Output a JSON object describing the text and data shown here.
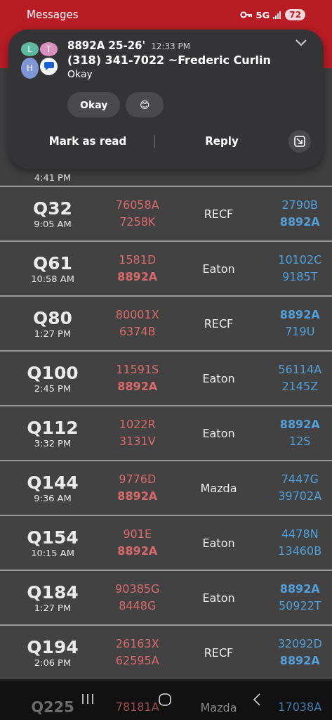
{
  "status_bar": {
    "app": "Messages",
    "network": "5G",
    "battery": "72"
  },
  "notification": {
    "avatar_letters": [
      "L",
      "T",
      "H"
    ],
    "title": "8892A 25-26'",
    "time": "12:33 PM",
    "sender": "(318) 341-7022 ~Frederic Curlin",
    "message": "Okay",
    "quick_replies": [
      "Okay",
      "😊"
    ],
    "actions": [
      "Mark as read",
      "Reply"
    ]
  },
  "partial_row": {
    "time": "4:41 PM"
  },
  "rows": [
    {
      "code": "Q32",
      "time": "9:05 AM",
      "left": [
        {
          "text": "76058A",
          "bold": false
        },
        {
          "text": "7258K",
          "bold": false
        }
      ],
      "make": "RECF",
      "right": [
        {
          "text": "2790B",
          "bold": false
        },
        {
          "text": "8892A",
          "bold": true
        }
      ]
    },
    {
      "code": "Q61",
      "time": "10:58 AM",
      "left": [
        {
          "text": "1581D",
          "bold": false
        },
        {
          "text": "8892A",
          "bold": true
        }
      ],
      "make": "Eaton",
      "right": [
        {
          "text": "10102C",
          "bold": false
        },
        {
          "text": "9185T",
          "bold": false
        }
      ]
    },
    {
      "code": "Q80",
      "time": "1:27 PM",
      "left": [
        {
          "text": "80001X",
          "bold": false
        },
        {
          "text": "6374B",
          "bold": false
        }
      ],
      "make": "RECF",
      "right": [
        {
          "text": "8892A",
          "bold": true
        },
        {
          "text": "719U",
          "bold": false
        }
      ]
    },
    {
      "code": "Q100",
      "time": "2:45 PM",
      "left": [
        {
          "text": "11591S",
          "bold": false
        },
        {
          "text": "8892A",
          "bold": true
        }
      ],
      "make": "Eaton",
      "right": [
        {
          "text": "56114A",
          "bold": false
        },
        {
          "text": "2145Z",
          "bold": false
        }
      ]
    },
    {
      "code": "Q112",
      "time": "3:32 PM",
      "left": [
        {
          "text": "1022R",
          "bold": false
        },
        {
          "text": "3131V",
          "bold": false
        }
      ],
      "make": "Eaton",
      "right": [
        {
          "text": "8892A",
          "bold": true
        },
        {
          "text": "12S",
          "bold": false
        }
      ]
    },
    {
      "code": "Q144",
      "time": "9:36 AM",
      "left": [
        {
          "text": "9776D",
          "bold": false
        },
        {
          "text": "8892A",
          "bold": true
        }
      ],
      "make": "Mazda",
      "right": [
        {
          "text": "7447G",
          "bold": false
        },
        {
          "text": "39702A",
          "bold": false
        }
      ]
    },
    {
      "code": "Q154",
      "time": "10:15 AM",
      "left": [
        {
          "text": "901E",
          "bold": false
        },
        {
          "text": "8892A",
          "bold": true
        }
      ],
      "make": "Eaton",
      "right": [
        {
          "text": "4478N",
          "bold": false
        },
        {
          "text": "13460B",
          "bold": false
        }
      ]
    },
    {
      "code": "Q184",
      "time": "1:27 PM",
      "left": [
        {
          "text": "90385G",
          "bold": false
        },
        {
          "text": "8448G",
          "bold": false
        }
      ],
      "make": "Eaton",
      "right": [
        {
          "text": "8892A",
          "bold": true
        },
        {
          "text": "50922T",
          "bold": false
        }
      ]
    },
    {
      "code": "Q194",
      "time": "2:06 PM",
      "left": [
        {
          "text": "26163X",
          "bold": false
        },
        {
          "text": "62595A",
          "bold": false
        }
      ],
      "make": "RECF",
      "right": [
        {
          "text": "32092D",
          "bold": false
        },
        {
          "text": "8892A",
          "bold": true
        }
      ]
    }
  ],
  "dimmed_row": {
    "code": "Q225",
    "left": "78181A",
    "make": "Mazda",
    "right": "17038A"
  }
}
